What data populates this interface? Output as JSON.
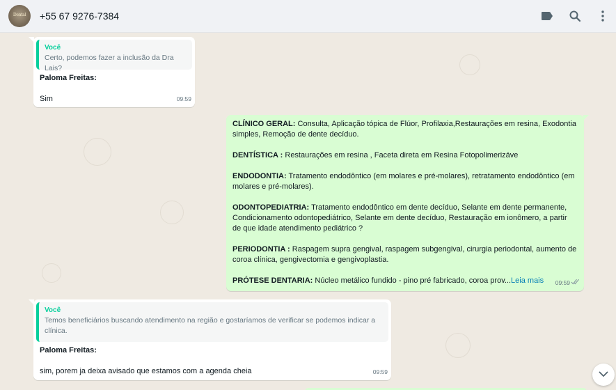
{
  "header": {
    "contact_name": "+55 67 9276-7384",
    "avatar_icon": "clinic-logo-avatar",
    "icons": [
      "label-icon",
      "search-icon",
      "more-vertical-icon"
    ]
  },
  "messages": [
    {
      "direction": "incoming",
      "quote": {
        "author": "Você",
        "text": "Certo, podemos fazer a inclusão da Dra Lais?"
      },
      "sender": "Paloma Freitas:",
      "text": "Sim",
      "time": "09:59"
    },
    {
      "direction": "outgoing",
      "sections": [
        {
          "title": "CLÍNICO GERAL:",
          "text": " Consulta, Aplicação tópica de Flúor, Profilaxia,Restaurações em resina, Exodontia simples, Remoção de dente decíduo."
        },
        {
          "title": "DENTÍSTICA :",
          "text": " Restaurações em resina , Faceta direta em Resina Fotopolimerizáve"
        },
        {
          "title": "ENDODONTIA:",
          "text": " Tratamento endodôntico (em molares e pré-molares), retratamento endodôntico (em molares e pré-molares)."
        },
        {
          "title": "ODONTOPEDIATRIA:",
          "text": " Tratamento endodôntico em dente decíduo, Selante em dente permanente, Condicionamento odontopediátrico, Selante em dente decíduo, Restauração em ionômero, a partir de que idade atendimento pediátrico ?"
        },
        {
          "title": "PERIODONTIA :",
          "text": " Raspagem supra gengival, raspagem subgengival, cirurgia periodontal, aumento de coroa clínica, gengivectomia e gengivoplastia."
        },
        {
          "title": "PRÓTESE DENTARIA:",
          "text": " Núcleo metálico fundido - pino pré fabricado, coroa prov..."
        }
      ],
      "read_more": "Leia mais",
      "time": "09:59",
      "status_icon": "double-check-icon"
    },
    {
      "direction": "incoming",
      "quote": {
        "author": "Você",
        "text": "Temos beneficiários buscando atendimento na região e gostaríamos de verificar se podemos indicar a clínica."
      },
      "sender": "Paloma Freitas:",
      "text": "sim, porem ja deixa avisado que estamos com a agenda cheia",
      "time": "09:59"
    }
  ],
  "scroll_button_icon": "chevron-down-icon",
  "colors": {
    "header_bg": "#f0f2f5",
    "chat_bg": "#efeae2",
    "incoming_bg": "#ffffff",
    "outgoing_bg": "#d9fdd3",
    "quote_accent": "#06cf9c",
    "read_more": "#027eb5"
  }
}
